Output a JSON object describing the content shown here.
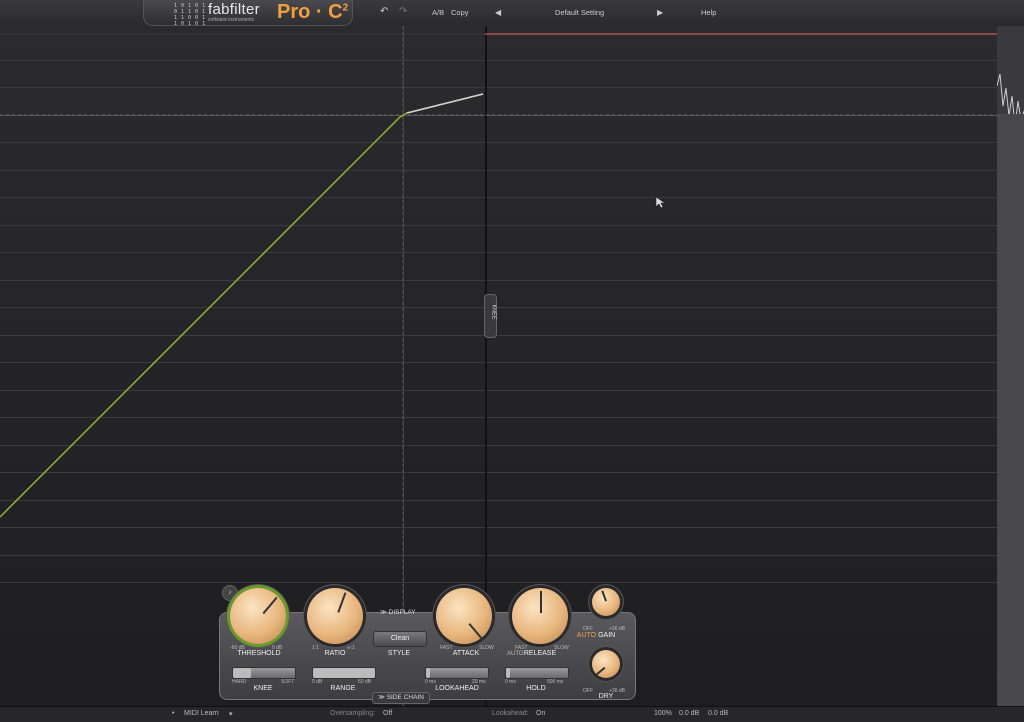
{
  "topbar": {
    "brand": "fabfilter",
    "tagline": "software instruments",
    "product": "Pro · C",
    "product_super": "2",
    "ab_label": "A/B",
    "copy_label": "Copy",
    "preset_name": "Default Setting",
    "help_label": "Help",
    "undo_icon": "undo-icon",
    "redo_icon": "redo-icon",
    "prev_icon": "triangle-left-icon",
    "next_icon": "triangle-right-icon"
  },
  "graph": {
    "knee_tab_label": "KNEE"
  },
  "panel": {
    "display_label": "DISPLAY",
    "sidechain_label": "SIDE CHAIN",
    "style_button": "Clean",
    "knobs": {
      "threshold": {
        "label": "THRESHOLD",
        "min": "-60 dB",
        "max": "0 dB"
      },
      "ratio": {
        "label": "RATIO",
        "min": "1:1",
        "max": "∞:1"
      },
      "style": {
        "label": "STYLE"
      },
      "attack": {
        "label": "ATTACK",
        "min": "FAST",
        "max": "SLOW"
      },
      "release": {
        "label": "RELEASE",
        "prefix": "AUTO",
        "min": "FAST",
        "max": "SLOW"
      },
      "gain": {
        "label": "GAIN",
        "auto": "AUTO",
        "min": "OFF",
        "max": "+36 dB"
      },
      "dry": {
        "label": "DRY",
        "min": "OFF",
        "max": "+36 dB"
      }
    },
    "sliders": {
      "knee": {
        "label": "KNEE",
        "min": "HARD",
        "max": "SOFT"
      },
      "range": {
        "label": "RANGE",
        "min": "0 dB",
        "max": "60 dB"
      },
      "lookahead": {
        "label": "LOOKAHEAD",
        "min": "0 ms",
        "max": "20 ms"
      },
      "hold": {
        "label": "HOLD",
        "min": "0 ms",
        "max": "500 ms"
      }
    }
  },
  "statusbar": {
    "midi_learn": "MIDI Learn",
    "oversampling_label": "Oversampling:",
    "oversampling_value": "Off",
    "lookahead_label": "Lookahead:",
    "lookahead_value": "On",
    "zoom": "100%",
    "in_level": "0.0 dB",
    "out_level": "0.0 dB"
  },
  "colors": {
    "accent": "#f0a040",
    "curve_green": "#8db33a",
    "knob": "#e8b67e",
    "threshold_red": "#c85a55"
  }
}
